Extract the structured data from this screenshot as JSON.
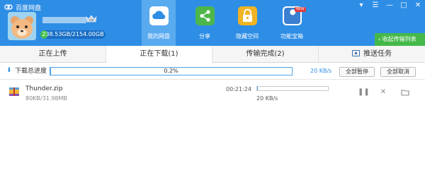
{
  "app": {
    "title": "百度网盘"
  },
  "window": {
    "menu_glyph": "▾",
    "skin_glyph": "☰",
    "minimize_glyph": "—",
    "maximize_glyph": "□",
    "close_glyph": "✕"
  },
  "user": {
    "vip_badge": "VIP",
    "quota_text": "238.53GB/2154.00GB",
    "quota_used_fraction": 0.111
  },
  "nav": {
    "items": [
      {
        "label": "我的网盘",
        "icon": "cloud-icon",
        "active": true,
        "color": "#5aaaf0"
      },
      {
        "label": "分享",
        "icon": "share-icon",
        "active": false,
        "color": "#4cb648"
      },
      {
        "label": "隐藏空间",
        "icon": "lock-icon",
        "active": false,
        "color": "#f0b323"
      },
      {
        "label": "功能宝箱",
        "icon": "wrench-icon",
        "active": false,
        "badge": "NEW",
        "color": "#3a7fd0"
      }
    ]
  },
  "collapse_button": {
    "label": "收起传输列表",
    "icon": "chevron-left-icon"
  },
  "tabs": [
    {
      "label": "正在上传",
      "active": false
    },
    {
      "label": "正在下载(1)",
      "active": true
    },
    {
      "label": "传输完成(2)",
      "active": false
    },
    {
      "label": "推送任务",
      "active": false,
      "icon": "push-task-icon"
    }
  ],
  "total": {
    "label": "下载总进度",
    "percent_text": "0.2%",
    "percent_value": 0.2,
    "speed": "20 KB/s",
    "pause_all": "全部暂停",
    "cancel_all": "全部取消"
  },
  "downloads": [
    {
      "name": "Thunder.zip",
      "size": "80KB/31.98MB",
      "time_left": "00:21:24",
      "speed": "20 KB/s",
      "progress_percent": 0.25,
      "icon": "zip-archive-icon",
      "pause_glyph": "❚❚",
      "cancel_glyph": "✕"
    }
  ],
  "colors": {
    "accent": "#2e8ee6",
    "green": "#45b84a",
    "progress": "#4da3ec"
  }
}
